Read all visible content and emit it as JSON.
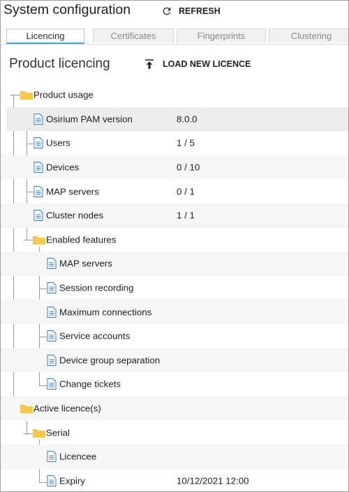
{
  "header": {
    "title": "System configuration",
    "refresh_label": "REFRESH",
    "refresh_icon": "refresh-icon"
  },
  "tabs": [
    {
      "label": "Licencing",
      "active": true
    },
    {
      "label": "Certificates",
      "active": false
    },
    {
      "label": "Fingerprints",
      "active": false
    },
    {
      "label": "Clustering",
      "active": false
    }
  ],
  "section": {
    "title": "Product licencing",
    "load_label": "LOAD NEW LICENCE",
    "load_icon": "upload-icon"
  },
  "tree": {
    "product_usage": {
      "label": "Product usage",
      "items": [
        {
          "label": "Osirium PAM version",
          "value": "8.0.0"
        },
        {
          "label": "Users",
          "value": "1 / 5"
        },
        {
          "label": "Devices",
          "value": "0 / 10"
        },
        {
          "label": "MAP servers",
          "value": "0 / 1"
        },
        {
          "label": "Cluster nodes",
          "value": "1 / 1"
        }
      ],
      "enabled_features": {
        "label": "Enabled features",
        "items": [
          {
            "label": "MAP servers"
          },
          {
            "label": "Session recording"
          },
          {
            "label": "Maximum connections"
          },
          {
            "label": "Service accounts"
          },
          {
            "label": "Device group separation"
          },
          {
            "label": "Change tickets"
          }
        ]
      }
    },
    "active_licences": {
      "label": "Active licence(s)",
      "serial": {
        "label": "Serial",
        "items": [
          {
            "label": "Licencee",
            "value": ""
          },
          {
            "label": "Expiry",
            "value": "10/12/2021 12:00"
          }
        ]
      }
    }
  },
  "colors": {
    "folder": "#f5c518",
    "document": "#2f7fc1",
    "tab_accent": "#42a5f5",
    "row_alt": "#f6f6f6",
    "row_selected": "#ececec"
  }
}
